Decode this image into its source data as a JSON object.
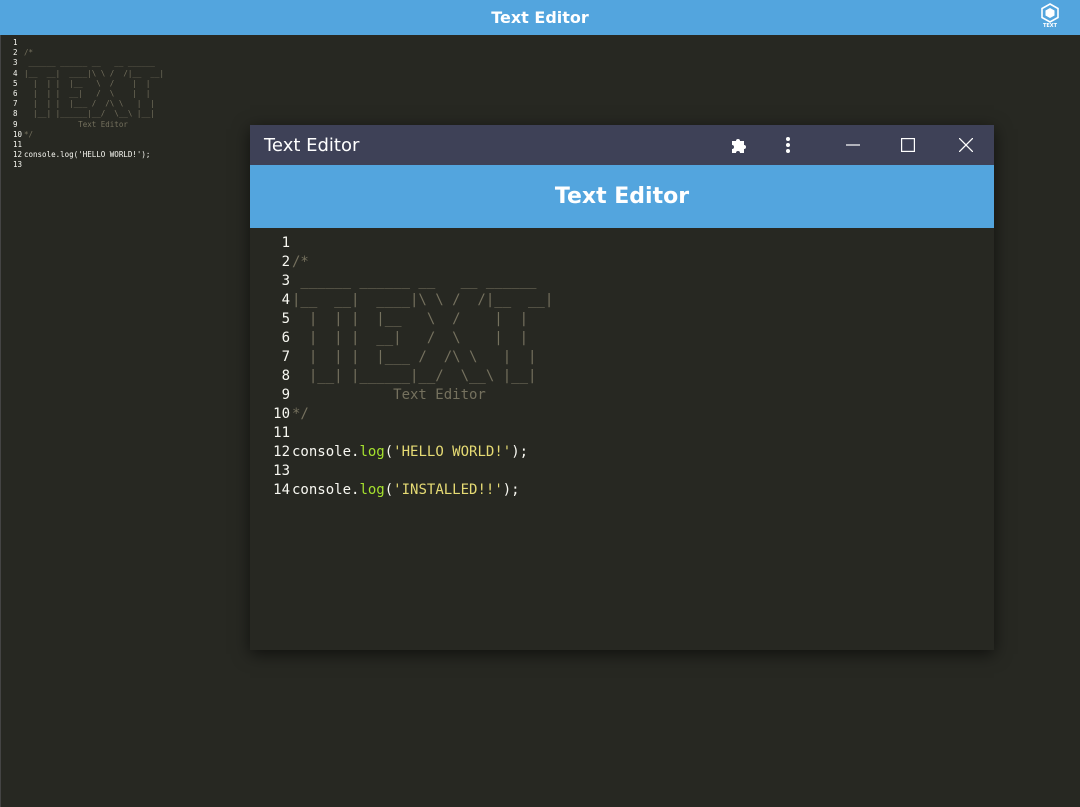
{
  "app": {
    "title": "Text Editor",
    "logo_text": "TEXT"
  },
  "window": {
    "title": "Text Editor",
    "header": "Text Editor",
    "buttons": {
      "extensions": "extensions-icon",
      "more": "more-icon",
      "minimize": "minimize-icon",
      "maximize": "maximize-icon",
      "close": "close-icon"
    }
  },
  "background_editor": {
    "lines": [
      {
        "n": "1",
        "text": ""
      },
      {
        "n": "2",
        "text": "/*"
      },
      {
        "n": "3",
        "text": " ______ ______ __   __ ______"
      },
      {
        "n": "4",
        "text": "|__  __|  ____|\\ \\ /  /|__  __|"
      },
      {
        "n": "5",
        "text": "  |  | |  |__   \\  /    |  |"
      },
      {
        "n": "6",
        "text": "  |  | |  __|   /  \\    |  |"
      },
      {
        "n": "7",
        "text": "  |  | |  |___ /  /\\ \\   |  |"
      },
      {
        "n": "8",
        "text": "  |__| |______|__/  \\__\\ |__|"
      },
      {
        "n": "9",
        "text": "            Text Editor"
      },
      {
        "n": "10",
        "text": "*/"
      },
      {
        "n": "11",
        "text": ""
      },
      {
        "n": "12",
        "code": "console.log('HELLO WORLD!');"
      },
      {
        "n": "13",
        "text": ""
      }
    ]
  },
  "editor": {
    "lines": [
      {
        "n": "1",
        "text": ""
      },
      {
        "n": "2",
        "text": "/*"
      },
      {
        "n": "3",
        "text": " ______ ______ __   __ ______"
      },
      {
        "n": "4",
        "text": "|__  __|  ____|\\ \\ /  /|__  __|"
      },
      {
        "n": "5",
        "text": "  |  | |  |__   \\  /    |  |"
      },
      {
        "n": "6",
        "text": "  |  | |  __|   /  \\    |  |"
      },
      {
        "n": "7",
        "text": "  |  | |  |___ /  /\\ \\   |  |"
      },
      {
        "n": "8",
        "text": "  |__| |______|__/  \\__\\ |__|"
      },
      {
        "n": "9",
        "text": "            Text Editor"
      },
      {
        "n": "10",
        "text": "*/"
      },
      {
        "n": "11",
        "text": ""
      },
      {
        "n": "12",
        "obj": "console.",
        "fn": "log",
        "open": "(",
        "str": "'HELLO WORLD!'",
        "close": ");"
      },
      {
        "n": "13",
        "text": ""
      },
      {
        "n": "14",
        "obj": "console.",
        "fn": "log",
        "open": "(",
        "str": "'INSTALLED!!'",
        "close": ");"
      }
    ]
  },
  "colors": {
    "accent": "#53a5de",
    "titlebar": "#3e4157",
    "editor_bg": "#272822",
    "comment": "#75715e",
    "function": "#a6e22e",
    "string": "#e6db74"
  }
}
